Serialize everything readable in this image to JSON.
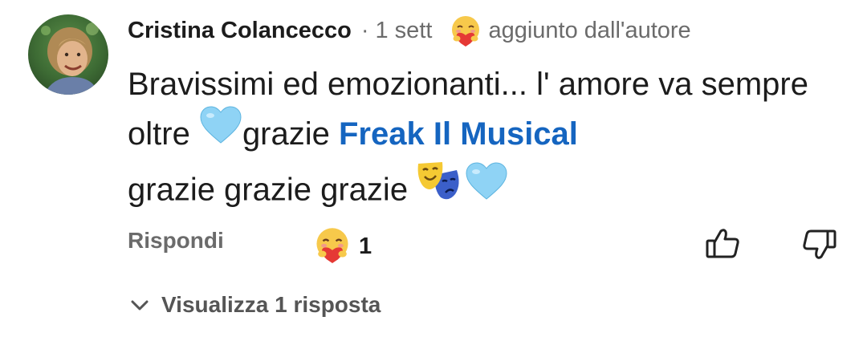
{
  "comment": {
    "author": "Cristina Colancecco",
    "separator": "·",
    "time": "1 sett",
    "author_badge_icon": "hugging-heart-icon",
    "author_badge": "aggiunto dall'autore",
    "text_part1": "Bravissimi ed emozionanti... l' amore va sempre oltre ",
    "heart_icon": "light-blue-heart-icon",
    "text_part2": "grazie ",
    "mention": "Freak Il Musical",
    "text_part3": " grazie grazie grazie ",
    "masks_icon": "performing-arts-icon",
    "mention_color": "#1565c0"
  },
  "actions": {
    "reply_label": "Rispondi",
    "reaction_icon": "hugging-heart-icon",
    "reaction_count": "1",
    "like_icon": "thumbs-up-icon",
    "dislike_icon": "thumbs-down-icon"
  },
  "replies": {
    "chevron_icon": "chevron-down-icon",
    "label": "Visualizza 1 risposta"
  }
}
